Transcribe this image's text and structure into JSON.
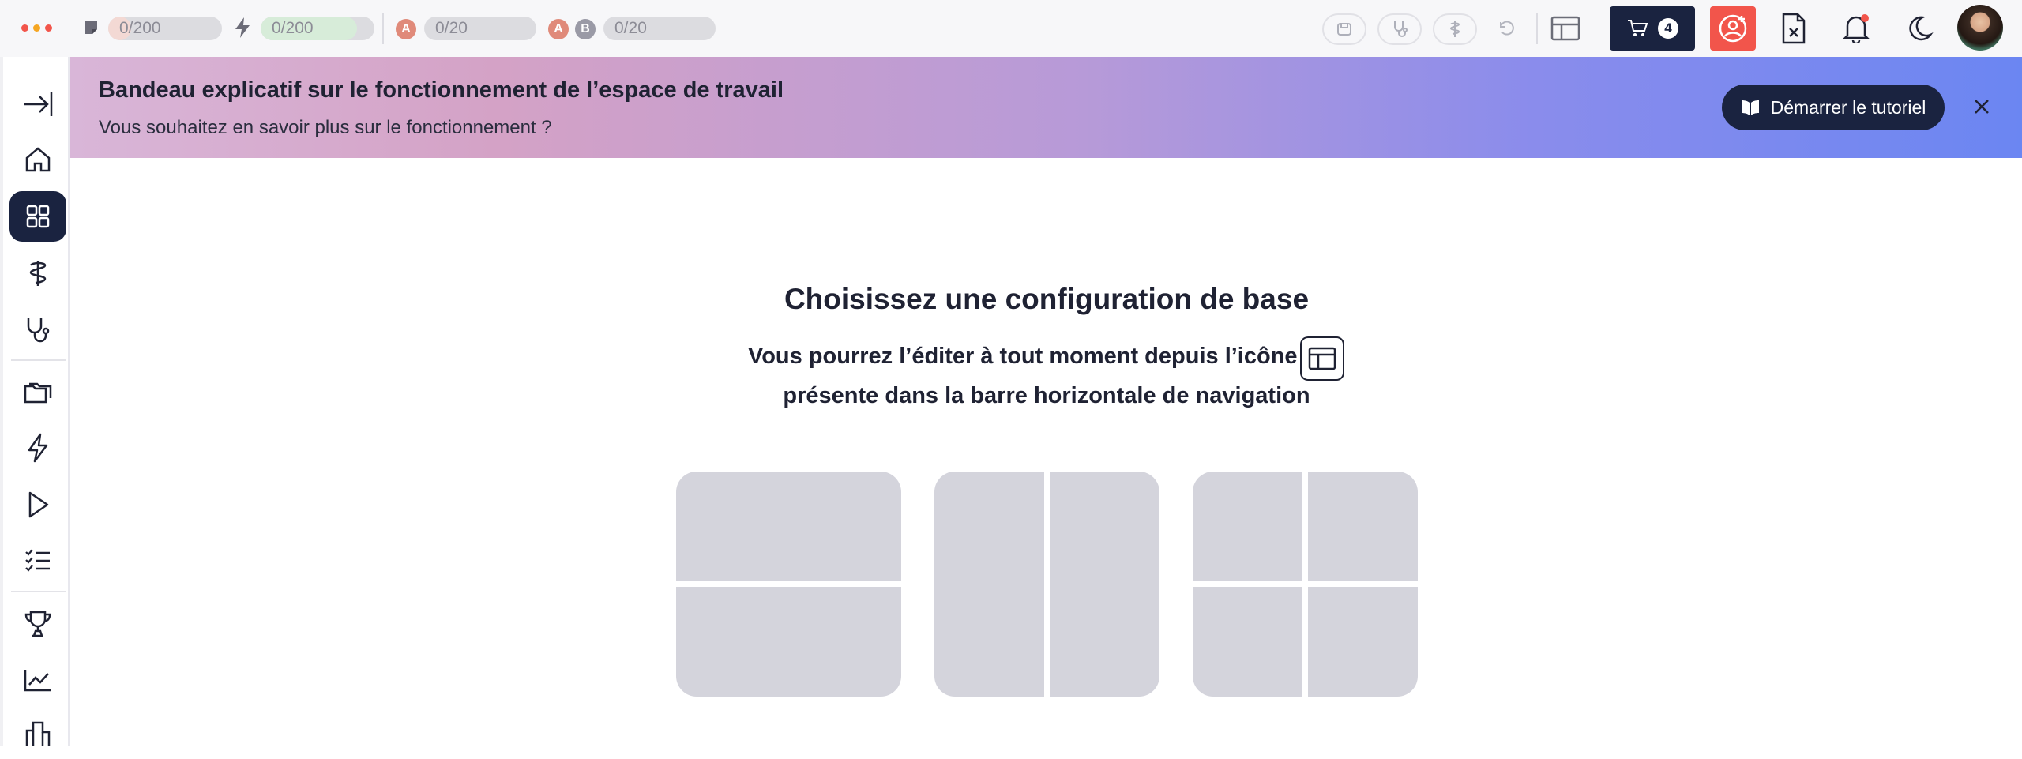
{
  "topbar": {
    "counters": [
      {
        "label": "0/200",
        "icon": "sticky-note-icon",
        "fill_fraction": 0.2,
        "fill_color": "#f3d9d4"
      },
      {
        "label": "0/200",
        "icon": "lightning-icon",
        "fill_fraction": 0.85,
        "fill_color": "#d7ecd9"
      },
      {
        "label": "0/20",
        "avatars": [
          "A"
        ]
      },
      {
        "label": "0/20",
        "avatars": [
          "A",
          "B"
        ]
      }
    ],
    "cart_count": "4",
    "colors": {
      "navy": "#1a2340",
      "red": "#f2554b",
      "avatar_a": "#e08a7a",
      "avatar_b": "#9a9aa6"
    }
  },
  "banner": {
    "title": "Bandeau explicatif sur le fonctionnement de l’espace de travail",
    "subtitle": "Vous souhaitez en savoir plus sur le fonctionnement ?",
    "button_label": "Démarrer le tutoriel"
  },
  "main": {
    "title": "Choisissez une configuration de base",
    "subtitle_part1": "Vous pourrez l’éditer à tout moment depuis l’icône",
    "subtitle_part2": "présente dans la barre horizontale de navigation",
    "layouts": [
      "two-rows",
      "two-columns",
      "four-quadrants"
    ]
  },
  "sidebar": {
    "items": [
      "expand-icon",
      "home-icon",
      "dashboard-icon",
      "caduceus-icon",
      "stethoscope-icon",
      "folders-icon",
      "lightning-icon",
      "play-icon",
      "checklist-icon",
      "trophy-icon",
      "chart-icon",
      "building-icon"
    ],
    "active": "dashboard-icon"
  }
}
